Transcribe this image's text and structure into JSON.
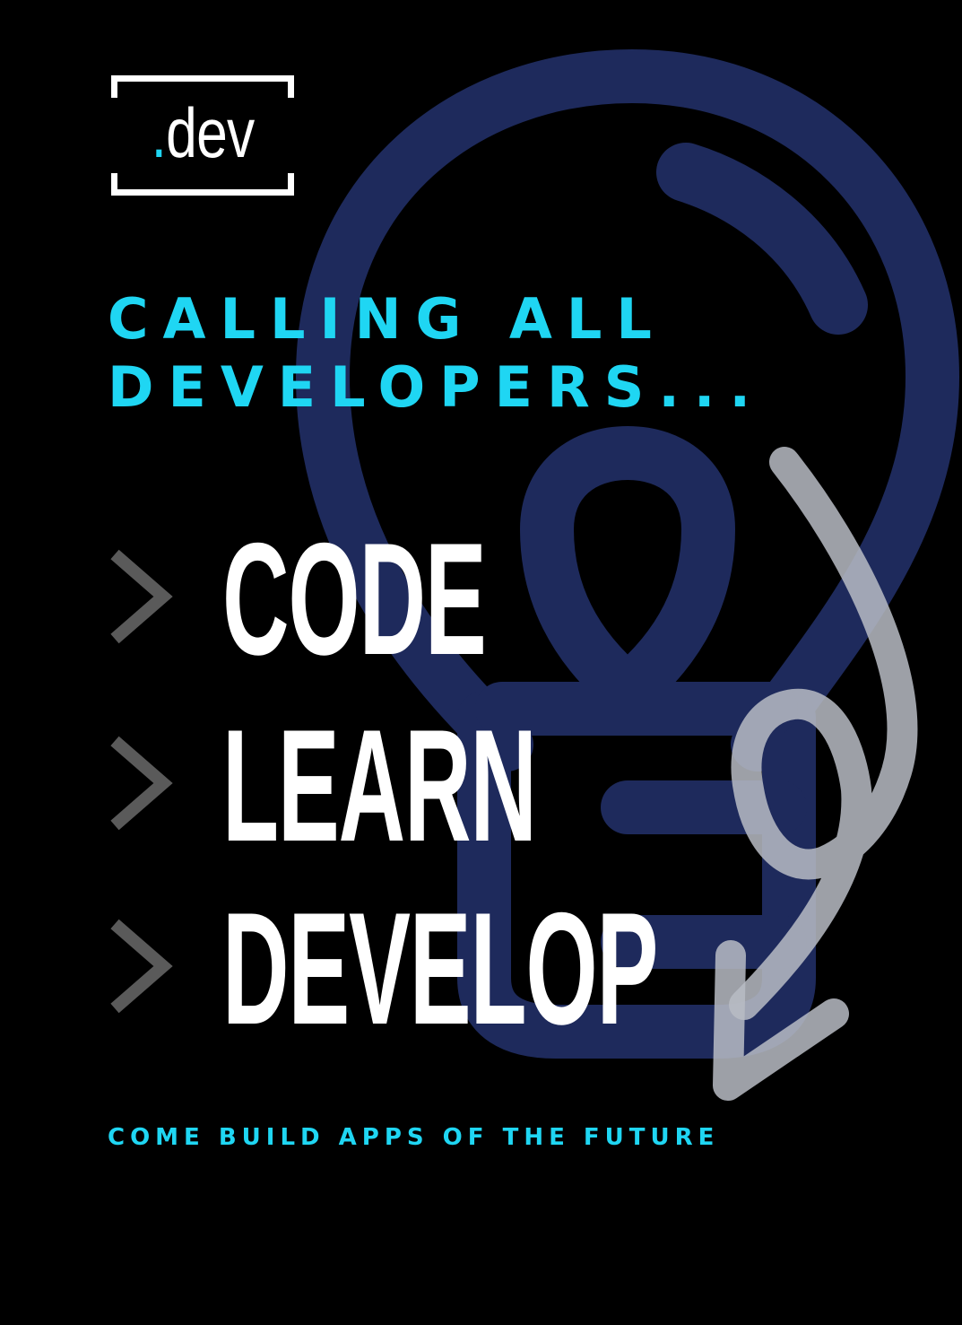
{
  "logo": {
    "dot": ".",
    "text": "dev"
  },
  "headline": {
    "line1": "CALLING ALL",
    "line2": "DEVELOPERS..."
  },
  "words": {
    "code": "CODE",
    "learn": "LEARN",
    "develop": "DEVELOP"
  },
  "tagline": "COME BUILD APPS OF THE FUTURE",
  "colors": {
    "background": "#000000",
    "accent": "#1fd6f3",
    "bulb": "#1e2a5c",
    "arrow": "#b9bcc4",
    "chevron": "#5a5a5a",
    "text": "#ffffff"
  },
  "icons": {
    "background": "lightbulb-icon",
    "overlay": "curved-arrow-icon",
    "bullet": "chevron-right-icon"
  }
}
